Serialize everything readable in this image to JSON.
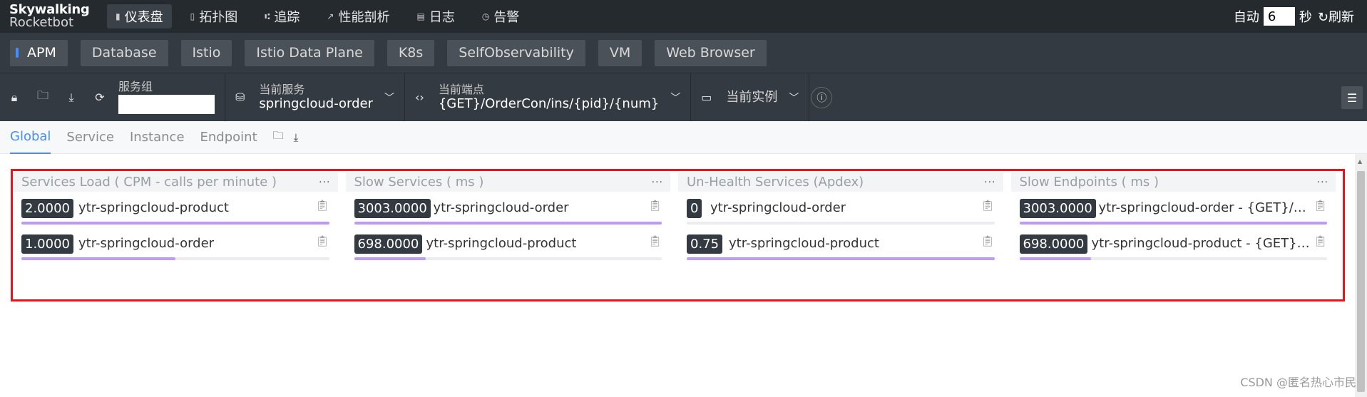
{
  "logo": {
    "line1": "Skywalking",
    "line2": "Rocketbot"
  },
  "nav": [
    {
      "icon": "▮",
      "label": "仪表盘",
      "active": true
    },
    {
      "icon": "▯",
      "label": "拓扑图",
      "active": false
    },
    {
      "icon": "⑆",
      "label": "追踪",
      "active": false
    },
    {
      "icon": "↗",
      "label": "性能剖析",
      "active": false
    },
    {
      "icon": "▤",
      "label": "日志",
      "active": false
    },
    {
      "icon": "◷",
      "label": "告警",
      "active": false
    }
  ],
  "top_right": {
    "auto_label": "自动",
    "interval": "6",
    "seconds_label": "秒",
    "refresh_label": "刷新"
  },
  "layers": [
    "APM",
    "Database",
    "Istio",
    "Istio Data Plane",
    "K8s",
    "SelfObservability",
    "VM",
    "Web Browser"
  ],
  "toolbar": {
    "group_label": "服务组",
    "service_label": "当前服务",
    "service_value": "springcloud-order",
    "endpoint_label": "当前端点",
    "endpoint_value": "{GET}/OrderCon/ins/{pid}/{num}",
    "instance_label": "当前实例"
  },
  "dashboard_tabs": [
    "Global",
    "Service",
    "Instance",
    "Endpoint"
  ],
  "widgets": [
    {
      "title": "Services Load ( CPM - calls per minute )",
      "rows": [
        {
          "value": "2.0000",
          "name": "ytr-springcloud-product",
          "ratio": 1.0
        },
        {
          "value": "1.0000",
          "name": "ytr-springcloud-order",
          "ratio": 0.5
        }
      ]
    },
    {
      "title": "Slow Services ( ms )",
      "rows": [
        {
          "value": "3003.0000",
          "name": "ytr-springcloud-order",
          "ratio": 1.0
        },
        {
          "value": "698.0000",
          "name": "ytr-springcloud-product",
          "ratio": 0.2324
        }
      ]
    },
    {
      "title": "Un-Health Services (Apdex)",
      "rows": [
        {
          "value": "0",
          "name": "ytr-springcloud-order",
          "ratio": 0.0
        },
        {
          "value": "0.75",
          "name": "ytr-springcloud-product",
          "ratio": 1.0
        }
      ]
    },
    {
      "title": "Slow Endpoints ( ms )",
      "rows": [
        {
          "value": "3003.0000",
          "name": "ytr-springcloud-order - {GET}/Or...",
          "ratio": 1.0
        },
        {
          "value": "698.0000",
          "name": "ytr-springcloud-product - {GET}/Pr...",
          "ratio": 0.2324
        }
      ]
    }
  ],
  "watermark": "CSDN @匿名热心市民",
  "colors": {
    "topbar": "#252a2f",
    "toolbar": "#333a41",
    "accent": "#448dfe",
    "bar_fill": "#bf99f8",
    "highlight": "#e8141c"
  }
}
